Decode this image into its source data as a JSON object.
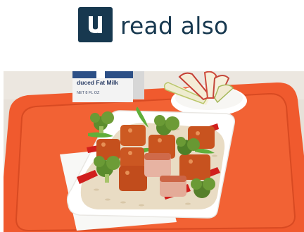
{
  "brand": {
    "mark_letter": "u",
    "wordmark": "read also",
    "color": "#17384f"
  },
  "photo": {
    "description_icon": "food-photo",
    "carton_text_line1": "duced Fat Milk",
    "carton_text_line2": "NET 8 FL OZ",
    "tray_color": "#f15a32",
    "plate_color": "#ffffff"
  }
}
